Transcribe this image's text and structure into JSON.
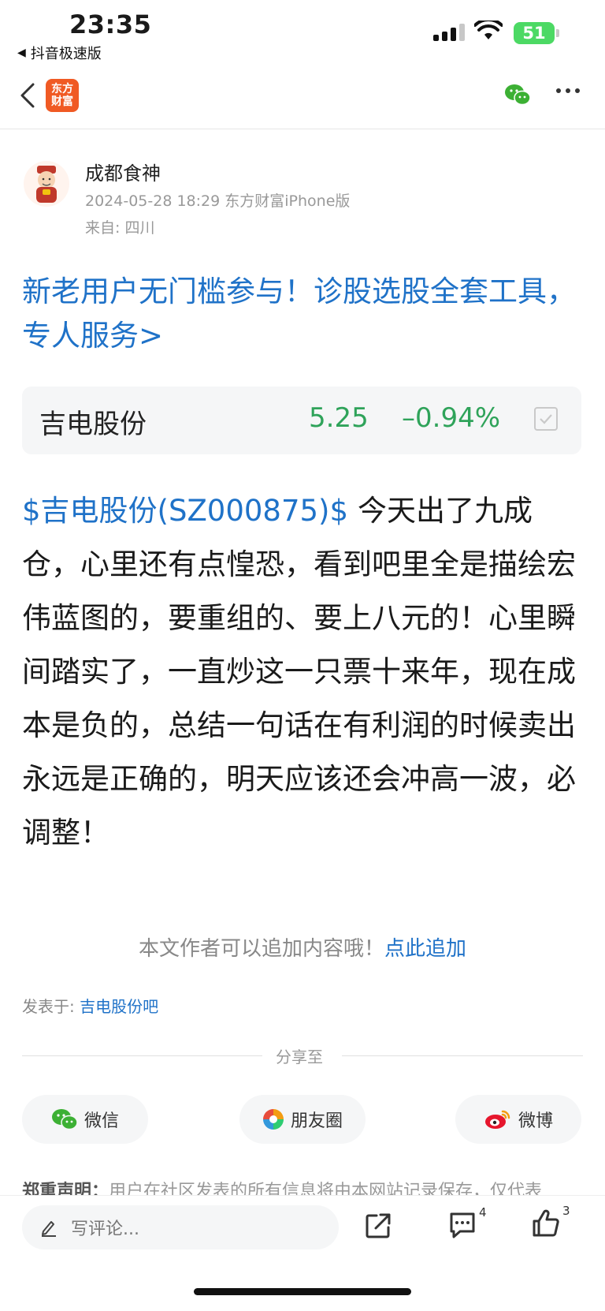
{
  "status_bar": {
    "time": "23:35",
    "back_app": "抖音极速版",
    "battery": "51"
  },
  "nav": {
    "logo_line1": "东方",
    "logo_line2": "财富"
  },
  "author": {
    "name": "成都食神",
    "meta": "2024-05-28 18:29 东方财富iPhone版",
    "from": "来自: 四川"
  },
  "promo": {
    "text": "新老用户无门槛参与！诊股选股全套工具，专人服务>"
  },
  "stock": {
    "name": "吉电股份",
    "price": "5.25",
    "change": "–0.94%"
  },
  "post": {
    "tag": "$吉电股份(SZ000875)$",
    "body": "今天出了九成仓，心里还有点惶恐，看到吧里全是描绘宏伟蓝图的，要重组的、要上八元的！心里瞬间踏实了，一直炒这一只票十来年，现在成本是负的，总结一句话在有利润的时候卖出永远是正确的，明天应该还会冲高一波，必调整！"
  },
  "append": {
    "hint": "本文作者可以追加内容哦！",
    "link": "点此追加"
  },
  "posted_in": {
    "label": "发表于: ",
    "link": "吉电股份吧"
  },
  "share": {
    "label": "分享至",
    "wechat": "微信",
    "moments": "朋友圈",
    "weibo": "微博"
  },
  "disclaimer": {
    "label": "郑重声明：",
    "text": "用户在社区发表的所有信息将由本网站记录保存，仅代表"
  },
  "bottom": {
    "placeholder": "写评论...",
    "comment_count": "4",
    "like_count": "3"
  },
  "colors": {
    "link_blue": "#1f72c8",
    "stock_green": "#2fa35a",
    "brand_orange": "#f05a24"
  }
}
